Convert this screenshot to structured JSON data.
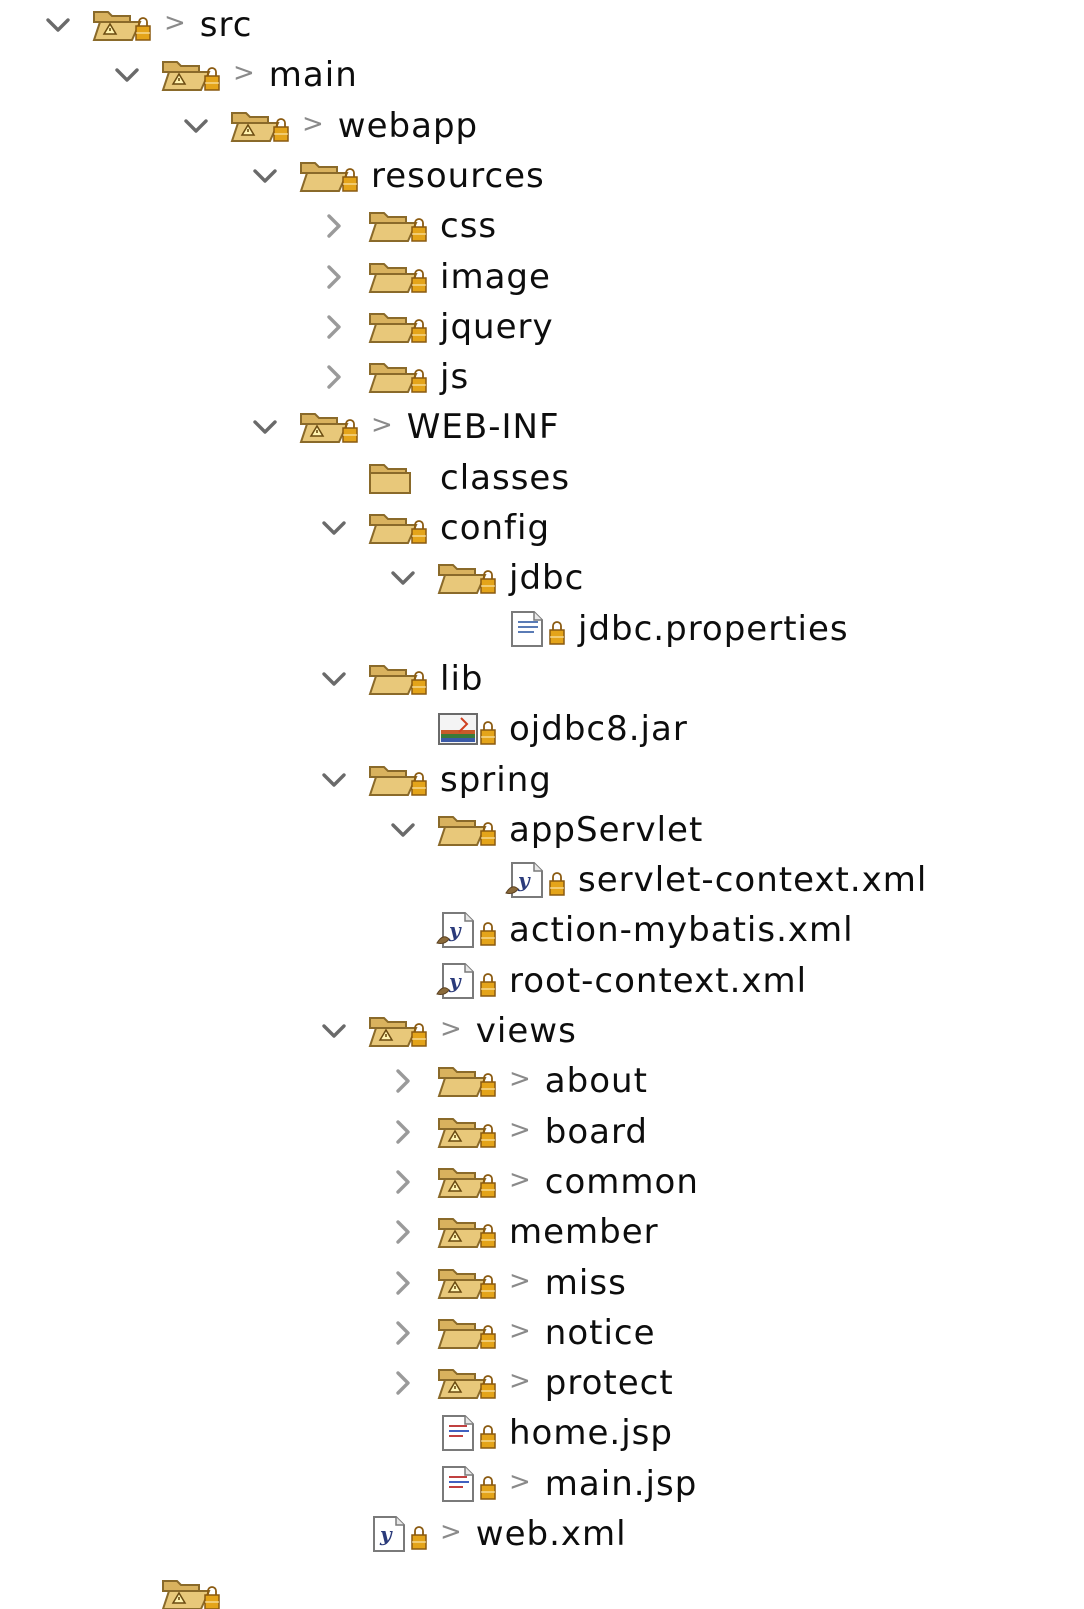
{
  "window": {
    "title": ""
  },
  "tree": [
    {
      "label": "src",
      "depth": 0,
      "state": "expanded",
      "kind": "folder-shared",
      "dirty": true
    },
    {
      "label": "main",
      "depth": 1,
      "state": "expanded",
      "kind": "folder-shared",
      "dirty": true
    },
    {
      "label": "webapp",
      "depth": 2,
      "state": "expanded",
      "kind": "folder-shared",
      "dirty": true
    },
    {
      "label": "resources",
      "depth": 3,
      "state": "expanded",
      "kind": "folder-open",
      "dirty": false
    },
    {
      "label": "css",
      "depth": 4,
      "state": "collapsed",
      "kind": "folder-open",
      "dirty": false
    },
    {
      "label": "image",
      "depth": 4,
      "state": "collapsed",
      "kind": "folder-open",
      "dirty": false
    },
    {
      "label": "jquery",
      "depth": 4,
      "state": "collapsed",
      "kind": "folder-open",
      "dirty": false
    },
    {
      "label": "js",
      "depth": 4,
      "state": "collapsed",
      "kind": "folder-open",
      "dirty": false
    },
    {
      "label": "WEB-INF",
      "depth": 3,
      "state": "expanded",
      "kind": "folder-shared",
      "dirty": true
    },
    {
      "label": "classes",
      "depth": 4,
      "state": "none",
      "kind": "folder-plain",
      "dirty": false
    },
    {
      "label": "config",
      "depth": 4,
      "state": "expanded",
      "kind": "folder-open",
      "dirty": false
    },
    {
      "label": "jdbc",
      "depth": 5,
      "state": "expanded",
      "kind": "folder-open",
      "dirty": false
    },
    {
      "label": "jdbc.properties",
      "depth": 6,
      "state": "none",
      "kind": "file-properties",
      "dirty": false
    },
    {
      "label": "lib",
      "depth": 4,
      "state": "expanded",
      "kind": "folder-open",
      "dirty": false
    },
    {
      "label": "ojdbc8.jar",
      "depth": 5,
      "state": "none",
      "kind": "file-jar",
      "dirty": false
    },
    {
      "label": "spring",
      "depth": 4,
      "state": "expanded",
      "kind": "folder-open",
      "dirty": false
    },
    {
      "label": "appServlet",
      "depth": 5,
      "state": "expanded",
      "kind": "folder-open",
      "dirty": false
    },
    {
      "label": "servlet-context.xml",
      "depth": 6,
      "state": "none",
      "kind": "file-spring-xml",
      "dirty": false
    },
    {
      "label": "action-mybatis.xml",
      "depth": 5,
      "state": "none",
      "kind": "file-spring-xml",
      "dirty": false
    },
    {
      "label": "root-context.xml",
      "depth": 5,
      "state": "none",
      "kind": "file-spring-xml",
      "dirty": false
    },
    {
      "label": "views",
      "depth": 4,
      "state": "expanded",
      "kind": "folder-shared",
      "dirty": true
    },
    {
      "label": "about",
      "depth": 5,
      "state": "collapsed",
      "kind": "folder-open",
      "dirty": true
    },
    {
      "label": "board",
      "depth": 5,
      "state": "collapsed",
      "kind": "folder-shared",
      "dirty": true
    },
    {
      "label": "common",
      "depth": 5,
      "state": "collapsed",
      "kind": "folder-shared",
      "dirty": true
    },
    {
      "label": "member",
      "depth": 5,
      "state": "collapsed",
      "kind": "folder-shared",
      "dirty": false
    },
    {
      "label": "miss",
      "depth": 5,
      "state": "collapsed",
      "kind": "folder-shared",
      "dirty": true
    },
    {
      "label": "notice",
      "depth": 5,
      "state": "collapsed",
      "kind": "folder-open",
      "dirty": true
    },
    {
      "label": "protect",
      "depth": 5,
      "state": "collapsed",
      "kind": "folder-shared",
      "dirty": true
    },
    {
      "label": "home.jsp",
      "depth": 5,
      "state": "none",
      "kind": "file-jsp",
      "dirty": false
    },
    {
      "label": "main.jsp",
      "depth": 5,
      "state": "none",
      "kind": "file-jsp",
      "dirty": true
    },
    {
      "label": "web.xml",
      "depth": 4,
      "state": "none",
      "kind": "file-xml",
      "dirty": true
    },
    {
      "label": "",
      "depth": 1,
      "state": "none",
      "kind": "folder-shared",
      "dirty": false,
      "clipped": true
    }
  ],
  "glyphs": {
    "dirty_marker": ">"
  },
  "colors": {
    "folder_body": "#e8c87a",
    "folder_back": "#d9b25e",
    "folder_stroke": "#8a6a2a",
    "lock": "#e4a41a",
    "lock_stroke": "#8a5a10",
    "arrow": "#6a6a6a",
    "text": "#0d0d0d"
  }
}
